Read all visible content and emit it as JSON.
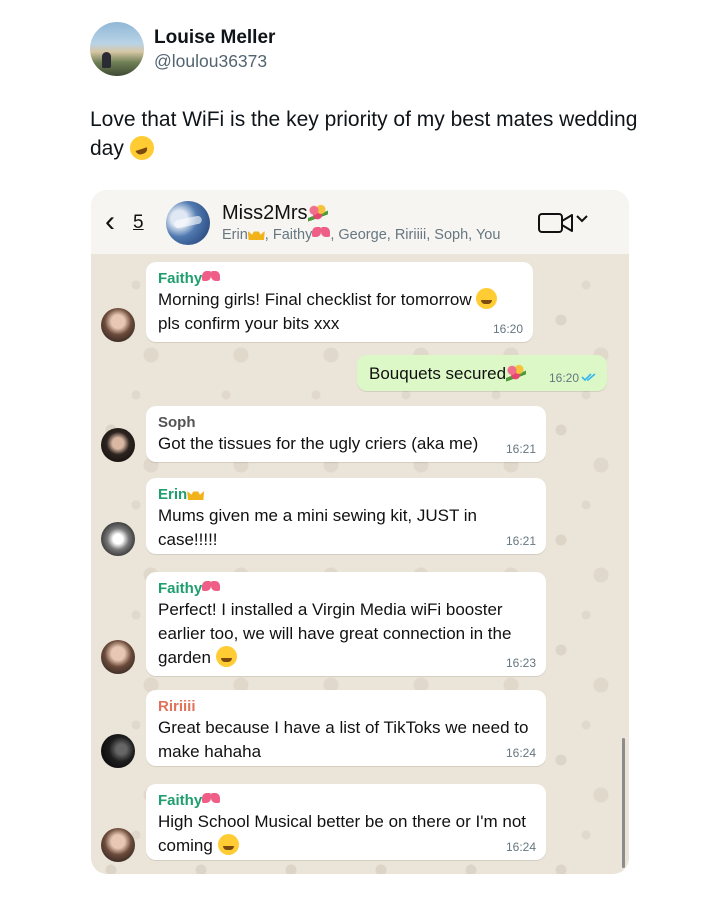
{
  "tweet": {
    "display_name": "Louise Meller",
    "handle": "@loulou36373",
    "text": "Love that WiFi is the key priority of my best mates wedding day",
    "text_emoji": "rolling-on-floor-laughing-emoji"
  },
  "chat": {
    "back_count": "5",
    "group_name": "Miss2Mrs",
    "members": {
      "erin": "Erin",
      "faithy": ", Faithy",
      "rest": ", George, Ririiii, Soph, You"
    },
    "messages": [
      {
        "sender": "Faithy",
        "sender_color": "#1f9e6e",
        "sender_emoji": "ribbon-emoji",
        "lines": [
          "Morning girls! Final checklist for tomorrow",
          "pls confirm your bits xxx"
        ],
        "time": "16:20",
        "emoji": "hushed-face-emoji"
      },
      {
        "outgoing": true,
        "text": "Bouquets secured",
        "emoji": "bouquet-emoji",
        "time": "16:20",
        "status": "read-double-tick"
      },
      {
        "sender": "Soph",
        "sender_color": "#545454",
        "lines": [
          "Got the tissues for the ugly criers (aka me)"
        ],
        "time": "16:21"
      },
      {
        "sender": "Erin",
        "sender_color": "#1f9e6e",
        "sender_emoji": "crown-emoji",
        "lines": [
          "Mums given me a mini sewing kit, JUST in",
          "case!!!!!"
        ],
        "time": "16:21"
      },
      {
        "sender": "Faithy",
        "sender_color": "#1f9e6e",
        "sender_emoji": "ribbon-emoji",
        "lines": [
          "Perfect! I installed a Virgin Media wiFi booster",
          "earlier too, we will have great connection in the",
          "garden"
        ],
        "time": "16:23",
        "emoji": "smirking-face-emoji"
      },
      {
        "sender": "Ririiii",
        "sender_color": "#e0735a",
        "lines": [
          "Great because I have a list of TikToks we need to",
          "make hahaha"
        ],
        "time": "16:24"
      },
      {
        "sender": "Faithy",
        "sender_color": "#1f9e6e",
        "sender_emoji": "ribbon-emoji",
        "lines": [
          "High School Musical better be on there or I'm not",
          "coming"
        ],
        "time": "16:24",
        "emoji": "rolling-on-floor-laughing-emoji"
      }
    ]
  },
  "colors": {
    "chat_background": "#ebe4d8",
    "outgoing_bubble": "#dcf8c6",
    "read_ticks": "#34b7f1"
  }
}
